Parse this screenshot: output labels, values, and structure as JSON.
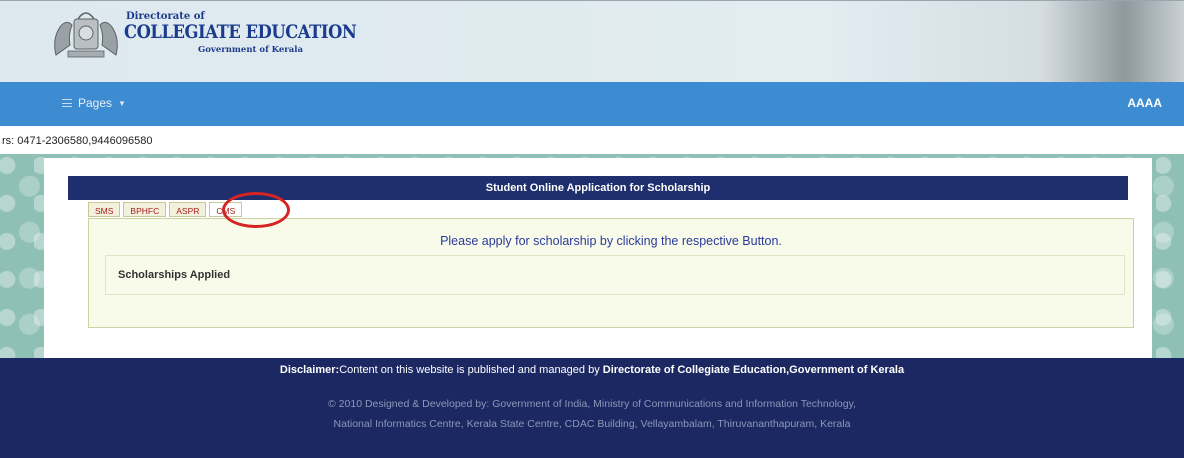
{
  "header": {
    "logo_line1": "Directorate of",
    "logo_line2": "COLLEGIATE EDUCATION",
    "logo_line3": "Government of Kerala"
  },
  "nav": {
    "pages_label": "Pages",
    "user_label": "AAAA"
  },
  "contact_text": "rs: 0471-2306580,9446096580",
  "main": {
    "title": "Student Online Application for Scholarship",
    "tabs": [
      {
        "label": "SMS"
      },
      {
        "label": "BPHFC"
      },
      {
        "label": "ASPR"
      },
      {
        "label": "CMS"
      }
    ],
    "apply_message": "Please apply for scholarship by clicking the respective Button.",
    "applied_heading": "Scholarships Applied"
  },
  "footer": {
    "disclaimer_label": "Disclaimer:",
    "disclaimer_text": "Content on this website is published and managed by ",
    "disclaimer_org": "Directorate of Collegiate Education,Government of Kerala",
    "credits_line1": "© 2010 Designed & Developed by: Government of India, Ministry of Communications and Information Technology,",
    "credits_line2": "National Informatics Centre, Kerala State Centre, CDAC Building, Vellayambalam, Thiruvananthapuram, Kerala"
  },
  "colors": {
    "navbar": "#3d8bd0",
    "title_bar": "#1f2f6e",
    "footer": "#1c2862",
    "highlight": "#d62424"
  }
}
